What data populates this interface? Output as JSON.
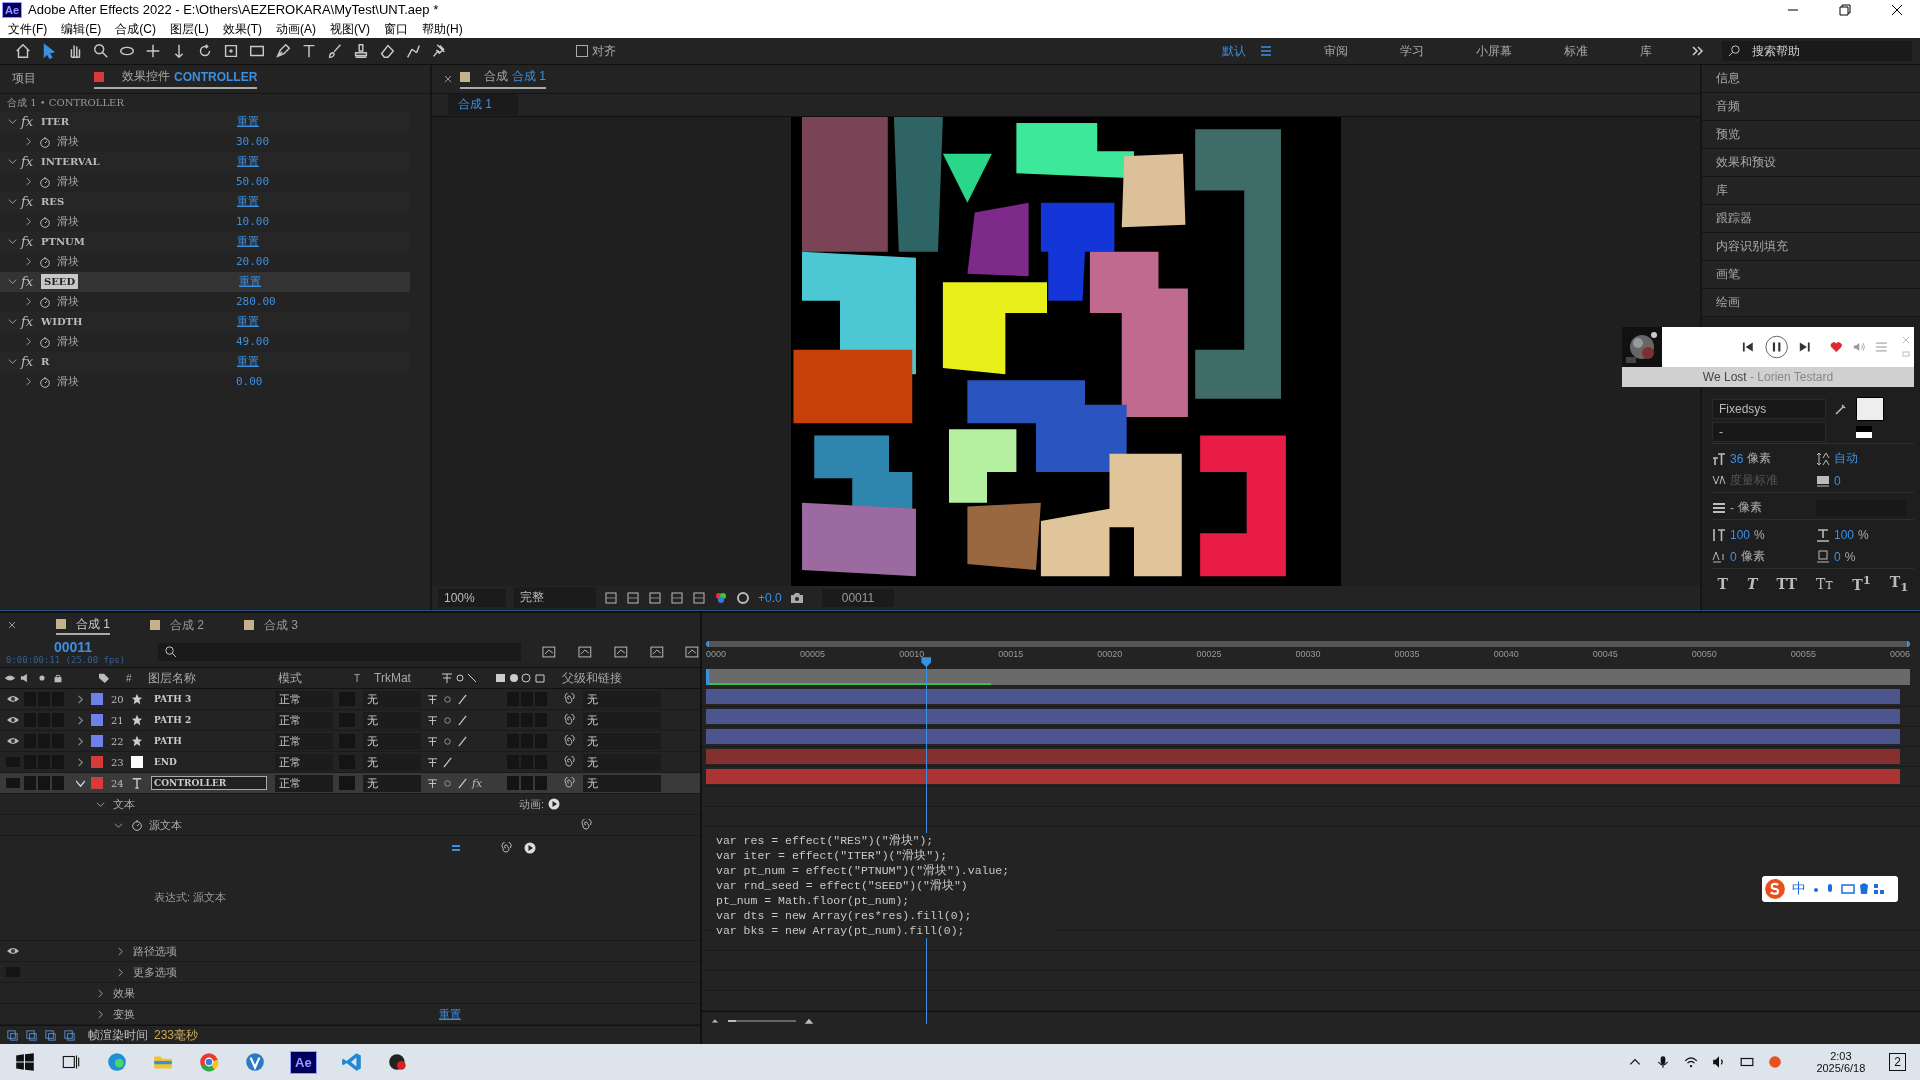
{
  "window": {
    "app_badge": "Ae",
    "title": "Adobe After Effects 2022 - E:\\Others\\AEZEROKARA\\MyTest\\UNT.aep *"
  },
  "menu": [
    "文件(F)",
    "编辑(E)",
    "合成(C)",
    "图层(L)",
    "效果(T)",
    "动画(A)",
    "视图(V)",
    "窗口",
    "帮助(H)"
  ],
  "toolbar": {
    "snap": {
      "label": "对齐",
      "checked": false
    },
    "workspaces": [
      {
        "label": "默认",
        "selected": true
      },
      {
        "label": "审阅",
        "selected": false
      },
      {
        "label": "学习",
        "selected": false
      },
      {
        "label": "小屏幕",
        "selected": false
      },
      {
        "label": "标准",
        "selected": false
      },
      {
        "label": "库",
        "selected": false
      }
    ],
    "search": {
      "placeholder": "搜索帮助"
    }
  },
  "effect_panel": {
    "tabs": [
      {
        "label": "项目",
        "selected": false
      },
      {
        "label": "效果控件",
        "target": "CONTROLLER",
        "selected": true
      }
    ],
    "breadcrumb": "合成 1 • CONTROLLER",
    "effects": [
      {
        "badge": "fx",
        "name": "ITER",
        "reset": "重置",
        "param": "滑块",
        "value": "30.00",
        "selected": false
      },
      {
        "badge": "fx",
        "name": "INTERVAL",
        "reset": "重置",
        "param": "滑块",
        "value": "50.00",
        "selected": false
      },
      {
        "badge": "fx",
        "name": "RES",
        "reset": "重置",
        "param": "滑块",
        "value": "10.00",
        "selected": false
      },
      {
        "badge": "fx",
        "name": "PTNUM",
        "reset": "重置",
        "param": "滑块",
        "value": "20.00",
        "selected": false
      },
      {
        "badge": "fx",
        "name": "SEED",
        "reset": "重置",
        "param": "滑块",
        "value": "280.00",
        "selected": true
      },
      {
        "badge": "fx",
        "name": "WIDTH",
        "reset": "重置",
        "param": "滑块",
        "value": "49.00",
        "selected": false
      },
      {
        "badge": "fx",
        "name": "R",
        "reset": "重置",
        "param": "滑块",
        "value": "0.00",
        "selected": false
      }
    ]
  },
  "composition": {
    "tab": {
      "label": "合成",
      "target": "合成 1"
    },
    "subtab": "合成 1",
    "footer": {
      "zoom": "100%",
      "resolution": "完整",
      "exposure": "+0.0",
      "timecode": "00011"
    }
  },
  "right_panels": [
    "信息",
    "音频",
    "预览",
    "效果和预设",
    "库",
    "跟踪器",
    "内容识别填充",
    "画笔",
    "绘画"
  ],
  "player": {
    "title": "We Lost",
    "separator": " - ",
    "artist": "Lorien Testard",
    "liked": true
  },
  "character": {
    "font": "Fixedsys",
    "style": "-",
    "size": {
      "value": "36",
      "unit": "像素"
    },
    "leading": {
      "value": "自动"
    },
    "kerning": {
      "value": "度量标准"
    },
    "tracking": {
      "value": "0"
    },
    "stroke": {
      "value": "-",
      "unit": "像素"
    },
    "vscale": {
      "value": "100",
      "unit": "%"
    },
    "hscale": {
      "value": "100",
      "unit": "%"
    },
    "baseline": {
      "value": "0",
      "unit": "像素"
    },
    "tsume": {
      "value": "0",
      "unit": "%"
    },
    "styles": [
      {
        "label": "T",
        "kind": "bold"
      },
      {
        "label": "T",
        "kind": "italic"
      },
      {
        "label": "TT",
        "kind": "caps"
      },
      {
        "label": "Tᴛ",
        "kind": "smallcaps"
      },
      {
        "label": "T$^{1}$",
        "kind": "super"
      },
      {
        "label": "T$_{1}$",
        "kind": "sub"
      }
    ]
  },
  "timeline": {
    "tabs": [
      {
        "label": "合成 1",
        "selected": true
      },
      {
        "label": "合成 2",
        "selected": false
      },
      {
        "label": "合成 3",
        "selected": false
      }
    ],
    "timecode": "00011",
    "fps": "0:00:00:11 (25.00 fps)",
    "columns": {
      "number": "#",
      "name": "图层名称",
      "mode": "模式",
      "t": "T",
      "trkmat": "TrkMat",
      "parent": "父级和链接"
    },
    "layers": [
      {
        "number": "20",
        "kind": "shape",
        "name": "PATH 3",
        "mode": "正常",
        "trkmat": "无",
        "parent": "无",
        "color": "#6f80e6",
        "visible": true,
        "selected": false,
        "expanded": false
      },
      {
        "number": "21",
        "kind": "shape",
        "name": "PATH 2",
        "mode": "正常",
        "trkmat": "无",
        "parent": "无",
        "color": "#6f80e6",
        "visible": true,
        "selected": false,
        "expanded": false
      },
      {
        "number": "22",
        "kind": "shape",
        "name": "PATH",
        "mode": "正常",
        "trkmat": "无",
        "parent": "无",
        "color": "#6f80e6",
        "visible": true,
        "selected": false,
        "expanded": false
      },
      {
        "number": "23",
        "kind": "solid",
        "name": "END",
        "mode": "正常",
        "trkmat": "无",
        "parent": "无",
        "color": "#d83a3a",
        "visible": false,
        "selected": false,
        "expanded": false
      },
      {
        "number": "24",
        "kind": "text",
        "name": "CONTROLLER",
        "mode": "正常",
        "trkmat": "无",
        "parent": "无",
        "color": "#d83a3a",
        "visible": false,
        "selected": true,
        "expanded": true,
        "fx": "fx"
      }
    ],
    "text_group": {
      "label": "文本",
      "expanded": true,
      "action": "动画:"
    },
    "source_text": {
      "label": "源文本",
      "expanded": true,
      "expression_label": "表达式: 源文本"
    },
    "sub_groups": [
      {
        "label": "路径选项",
        "expanded": false,
        "visible": true
      },
      {
        "label": "更多选项",
        "expanded": false,
        "visible": false
      }
    ],
    "groups": [
      {
        "label": "效果",
        "expanded": false
      },
      {
        "label": "变换",
        "expanded": false,
        "reset": "重置"
      }
    ],
    "ruler": [
      "0000",
      "00005",
      "00010",
      "00015",
      "00020",
      "00025",
      "00030",
      "00035",
      "00040",
      "00045",
      "00050",
      "00055",
      "0006"
    ],
    "render_bar": {
      "level": 0.235
    },
    "code": [
      "var res = effect(\"RES\")(\"滑块\");",
      "var iter = effect(\"ITER\")(\"滑块\");",
      "var pt_num = effect(\"PTNUM\")(\"滑块\").value;",
      "var rnd_seed = effect(\"SEED\")(\"滑块\")",
      "pt_num = Math.floor(pt_num);",
      "var dts = new Array(res*res).fill(0);",
      "var bks = new Array(pt_num).fill(0);"
    ],
    "status": {
      "label": "帧渲染时间",
      "value": "233毫秒"
    }
  },
  "ime_bar": {
    "label": "中"
  },
  "taskbar": {
    "app_badge": "Ae",
    "time": "2:03",
    "date": "2025/6/18",
    "notifications": "2"
  }
}
